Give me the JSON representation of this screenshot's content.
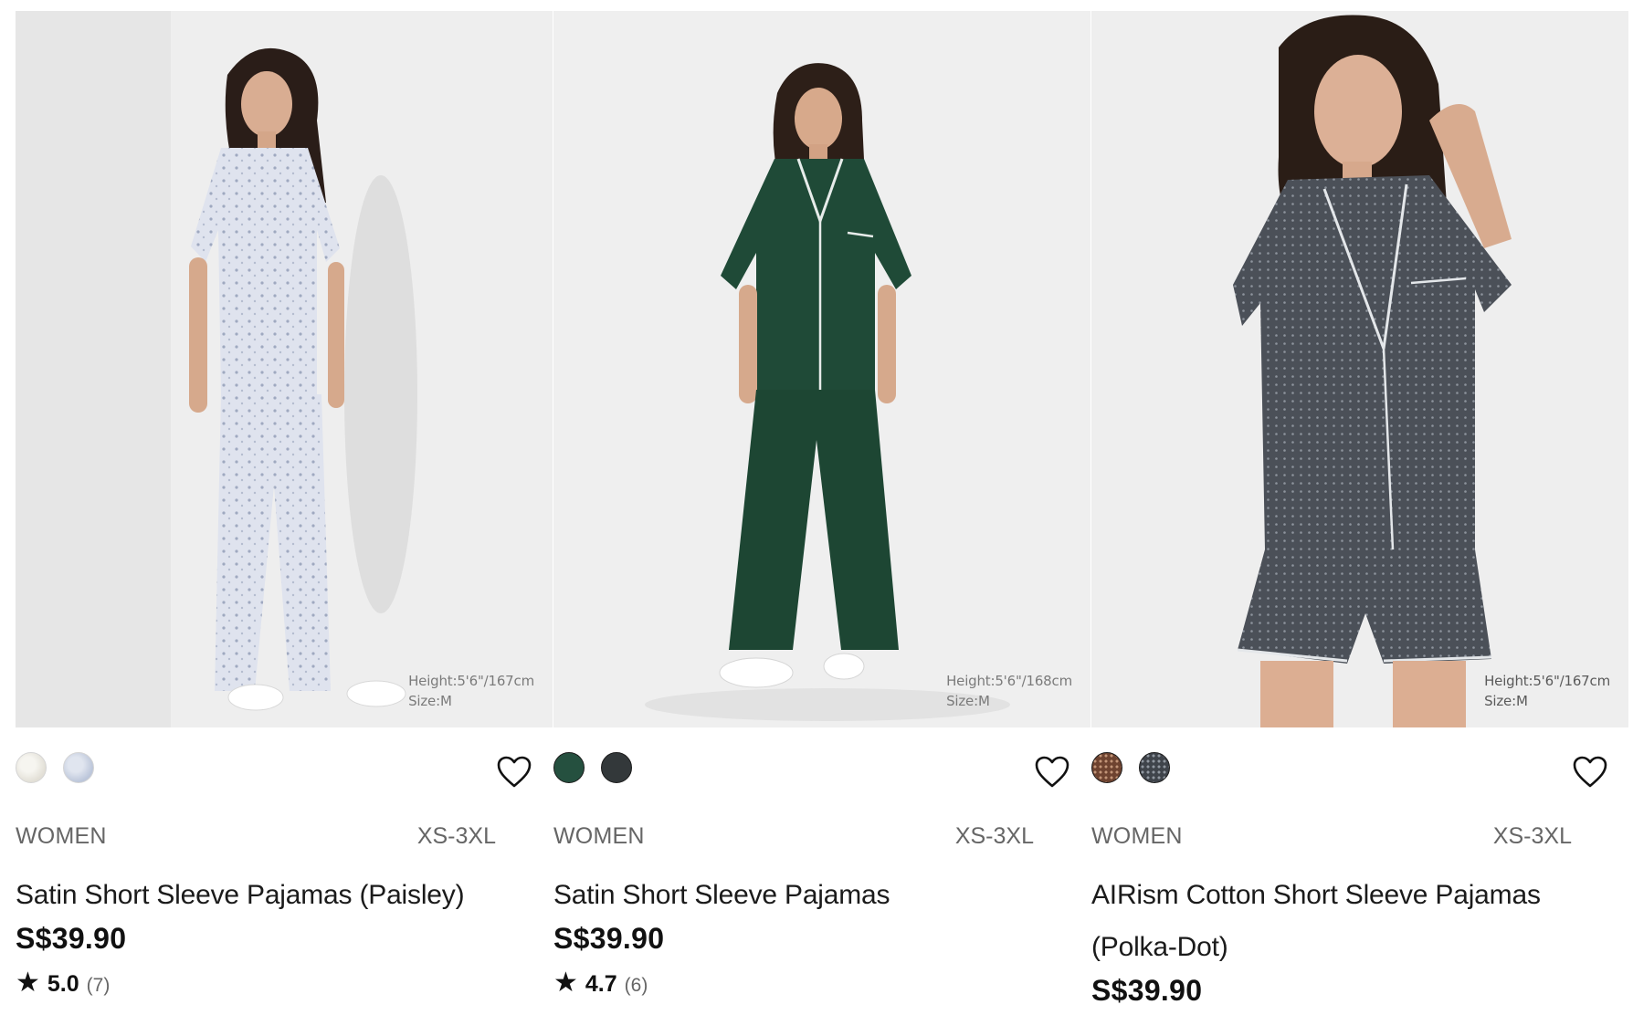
{
  "products": [
    {
      "model_height": "Height:5'6\"/167cm",
      "model_size": "Size:M",
      "colors": [
        {
          "name": "off-white paisley",
          "hex": "#eeece6"
        },
        {
          "name": "light blue paisley",
          "hex": "#cfd5e4"
        }
      ],
      "gender": "WOMEN",
      "size_range": "XS-3XL",
      "name": "Satin Short Sleeve Pajamas (Paisley)",
      "price": "S$39.90",
      "rating": "5.0",
      "review_count": "(7)",
      "favorite_icon": "heart-outline-icon"
    },
    {
      "model_height": "Height:5'6\"/168cm",
      "model_size": "Size:M",
      "colors": [
        {
          "name": "dark green",
          "hex": "#25503f"
        },
        {
          "name": "charcoal",
          "hex": "#33383a"
        }
      ],
      "gender": "WOMEN",
      "size_range": "XS-3XL",
      "name": "Satin Short Sleeve Pajamas",
      "price": "S$39.90",
      "rating": "4.7",
      "review_count": "(6)",
      "favorite_icon": "heart-outline-icon"
    },
    {
      "model_height": "Height:5'6\"/167cm",
      "model_size": "Size:M",
      "colors": [
        {
          "name": "brown polka-dot",
          "hex": "#7a4c36"
        },
        {
          "name": "gray polka-dot",
          "hex": "#4a4f55"
        }
      ],
      "gender": "WOMEN",
      "size_range": "XS-3XL",
      "name": "AIRism Cotton Short Sleeve Pajamas (Polka-Dot)",
      "price": "S$39.90",
      "favorite_icon": "heart-outline-icon"
    }
  ],
  "icons": {
    "rating_star": "★"
  }
}
